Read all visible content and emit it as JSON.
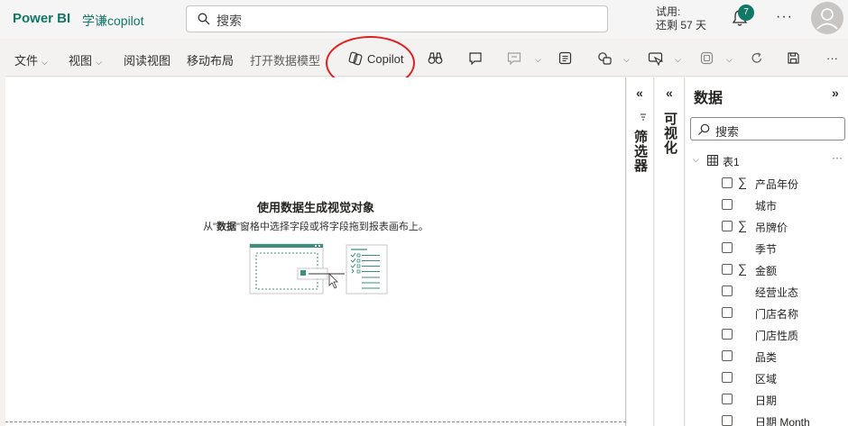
{
  "topbar": {
    "brand": "Power BI",
    "workspace": "学谦copilot",
    "search_placeholder": "搜索",
    "trial_line1": "试用:",
    "trial_line2": "还剩 57 天",
    "notification_count": "7",
    "more": "···"
  },
  "ribbon": {
    "file": "文件",
    "view": "视图",
    "reading_view": "阅读视图",
    "mobile_layout": "移动布局",
    "open_model": "打开数据模型",
    "copilot": "Copilot",
    "more": "···"
  },
  "canvas": {
    "empty_title": "使用数据生成视觉对象",
    "empty_desc_pre": "从\"",
    "empty_desc_bold": "数据",
    "empty_desc_post": "\"窗格中选择字段或将字段拖到报表画布上。"
  },
  "panes": {
    "filters": "筛选器",
    "visualizations": "可视化",
    "data": {
      "title": "数据",
      "search_placeholder": "搜索",
      "table_name": "表1",
      "fields": [
        {
          "label": "产品年份",
          "sigma": true
        },
        {
          "label": "城市",
          "sigma": false
        },
        {
          "label": "吊牌价",
          "sigma": true
        },
        {
          "label": "季节",
          "sigma": false
        },
        {
          "label": "金额",
          "sigma": true
        },
        {
          "label": "经营业态",
          "sigma": false
        },
        {
          "label": "门店名称",
          "sigma": false
        },
        {
          "label": "门店性质",
          "sigma": false
        },
        {
          "label": "品类",
          "sigma": false
        },
        {
          "label": "区域",
          "sigma": false
        },
        {
          "label": "日期",
          "sigma": false
        },
        {
          "label": "日期 Month",
          "sigma": false
        }
      ]
    }
  },
  "colors": {
    "brand": "#117865",
    "highlight_circle": "#e02020"
  }
}
